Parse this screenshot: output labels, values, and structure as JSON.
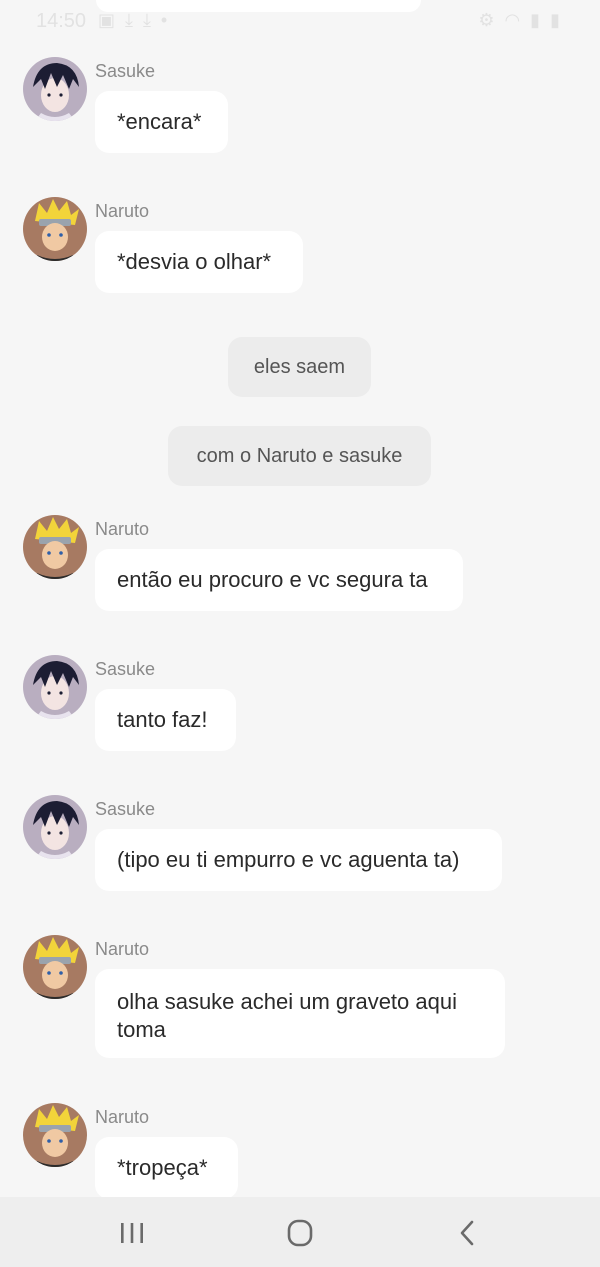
{
  "status_bar": {
    "time": "14:50"
  },
  "messages": [
    {
      "type": "user",
      "sender": "Sasuke",
      "text": "*encara*",
      "avatar": "sasuke-avatar"
    },
    {
      "type": "user",
      "sender": "Naruto",
      "text": "*desvia o olhar*",
      "avatar": "naruto-avatar"
    },
    {
      "type": "system",
      "text": "eles saem"
    },
    {
      "type": "system",
      "text": "com o Naruto e sasuke"
    },
    {
      "type": "user",
      "sender": "Naruto",
      "text": "então eu procuro e vc segura ta",
      "avatar": "naruto-avatar"
    },
    {
      "type": "user",
      "sender": "Sasuke",
      "text": "tanto faz!",
      "avatar": "sasuke-avatar"
    },
    {
      "type": "user",
      "sender": "Sasuke",
      "text": "(tipo eu ti empurro e vc aguenta ta)",
      "avatar": "sasuke-avatar"
    },
    {
      "type": "user",
      "sender": "Naruto",
      "text": "olha sasuke achei um graveto aqui toma",
      "avatar": "naruto-avatar"
    },
    {
      "type": "user",
      "sender": "Naruto",
      "text": "*tropeça*",
      "avatar": "naruto-avatar"
    }
  ],
  "nav": {
    "icons": [
      "recent-apps-icon",
      "home-icon",
      "back-icon"
    ]
  },
  "colors": {
    "background": "#f6f6f6",
    "bubble": "#ffffff",
    "system_bubble": "#ececec",
    "sender_name": "#8a8a8a",
    "navbar": "#eeeeee"
  }
}
